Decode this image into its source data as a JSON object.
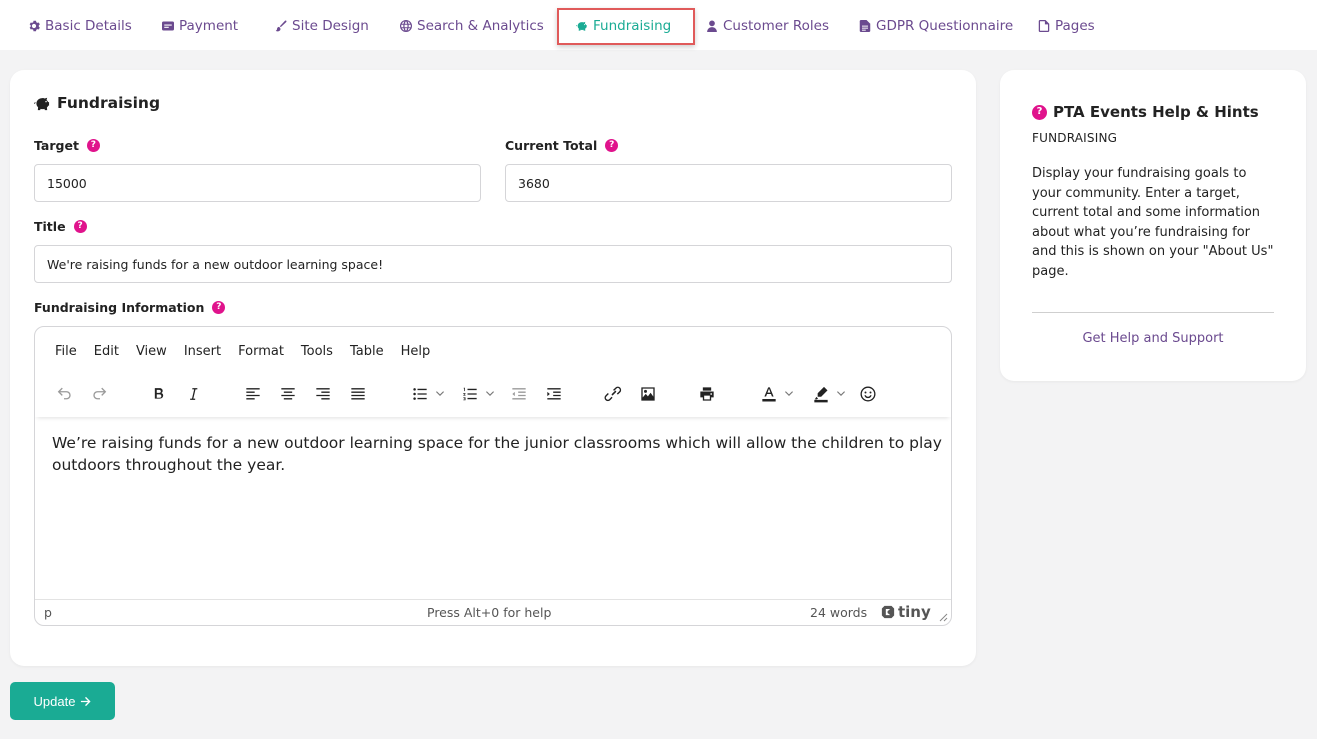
{
  "nav": {
    "items": [
      {
        "label": "Basic Details",
        "icon": "gear-icon"
      },
      {
        "label": "Payment",
        "icon": "stripe-icon"
      },
      {
        "label": "Site Design",
        "icon": "brush-icon"
      },
      {
        "label": "Search & Analytics",
        "icon": "globe-icon"
      },
      {
        "label": "Fundraising",
        "icon": "piggy-bank-icon",
        "active": true
      },
      {
        "label": "Customer Roles",
        "icon": "user-icon"
      },
      {
        "label": "GDPR Questionnaire",
        "icon": "file-text-icon"
      },
      {
        "label": "Pages",
        "icon": "file-icon"
      }
    ]
  },
  "fundraising": {
    "title": "Fundraising",
    "target_label": "Target",
    "target_value": "15000",
    "current_label": "Current Total",
    "current_value": "3680",
    "title_label": "Title",
    "title_value": "We're raising funds for a new outdoor learning space!",
    "info_label": "Fundraising Information"
  },
  "editor": {
    "menu": [
      "File",
      "Edit",
      "View",
      "Insert",
      "Format",
      "Tools",
      "Table",
      "Help"
    ],
    "content": "We’re raising funds for a new outdoor learning space for the junior classrooms which will allow the children to play outdoors throughout the year.",
    "status_path": "p",
    "status_help": "Press Alt+0 for help",
    "status_words": "24 words",
    "brand": "tiny"
  },
  "help": {
    "title": "PTA Events Help & Hints",
    "subtitle": "FUNDRAISING",
    "body": "Display your fundraising goals to your community. Enter a target, current total and some information about what you’re fundraising for and this is shown on your \"About Us\" page.",
    "link": "Get Help and Support"
  },
  "update_button": {
    "label": "Update"
  },
  "colors": {
    "accent": "#1aab94",
    "nav": "#6b4a8f",
    "help_dot": "#e0138c",
    "highlight_border": "#e05a5a"
  }
}
